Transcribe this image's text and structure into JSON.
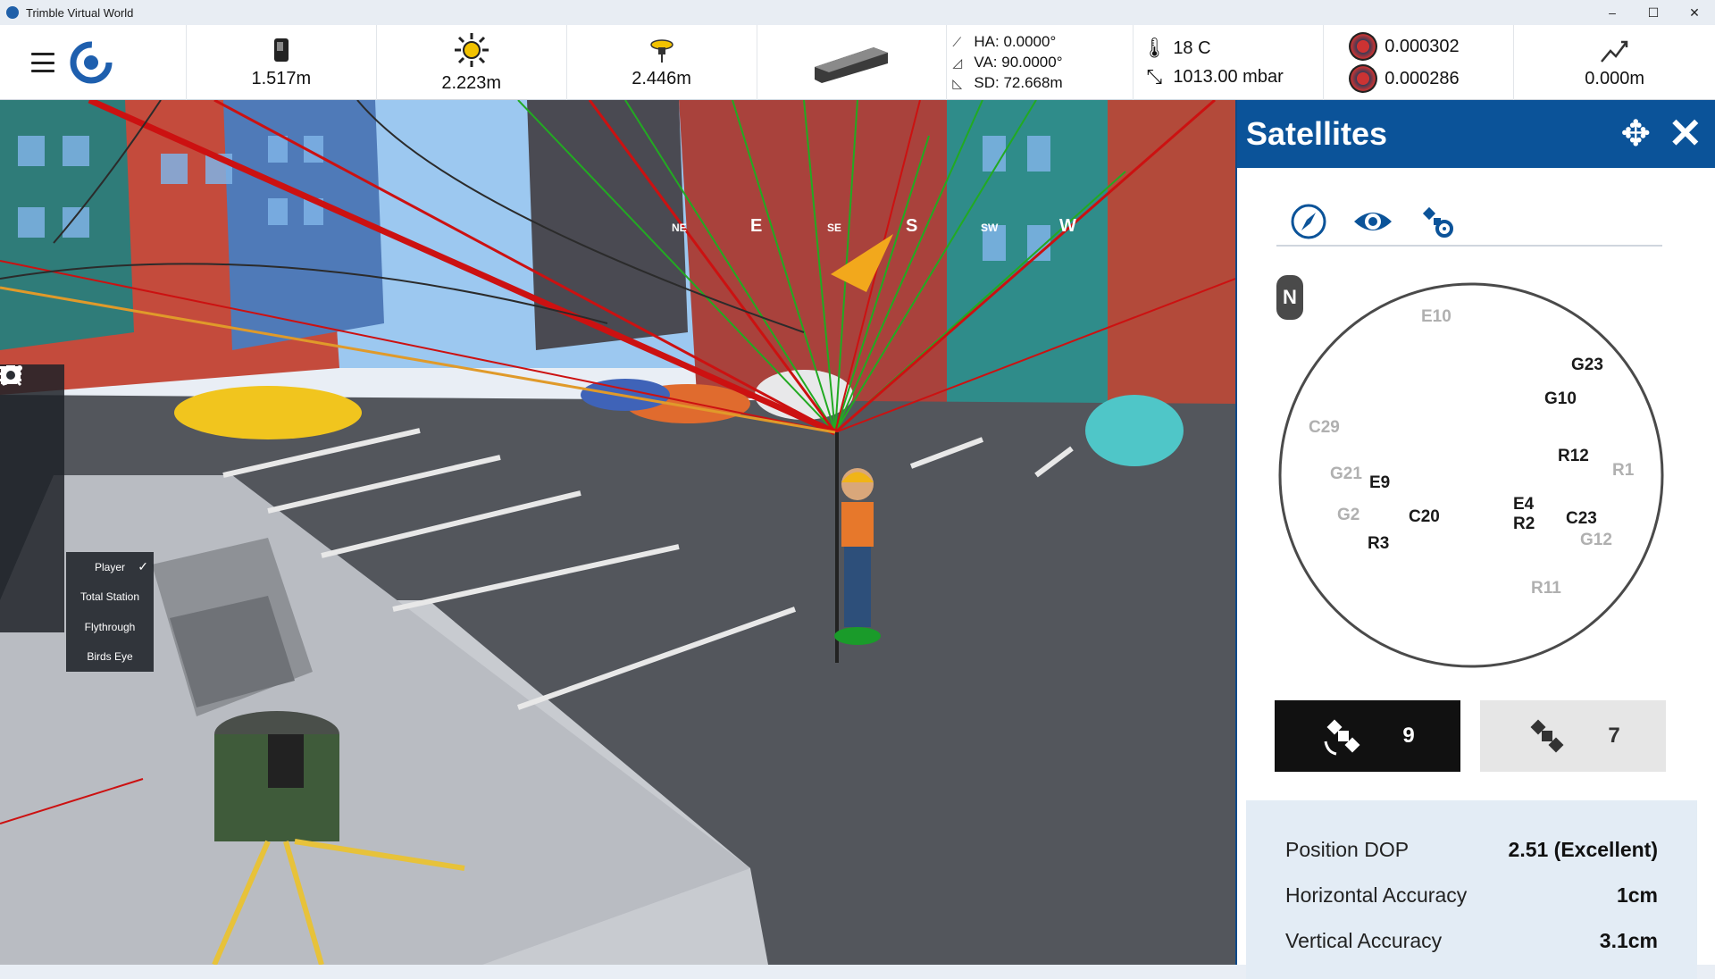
{
  "window": {
    "title": "Trimble Virtual World",
    "minimize": "–",
    "maximize": "☐",
    "close": "✕"
  },
  "toolbar": {
    "measure1": {
      "icon": "receiver-icon",
      "value": "1.517m"
    },
    "measure2": {
      "icon": "prism-sun-icon",
      "value": "2.223m"
    },
    "measure3": {
      "icon": "gnss-antenna-icon",
      "value": "2.446m"
    },
    "angles": {
      "ha": "HA: 0.0000°",
      "va": "VA: 90.0000°",
      "sd": "SD: 72.668m"
    },
    "weather": {
      "temperature": "18 C",
      "pressure": "1013.00 mbar"
    },
    "precision": {
      "horizontal": "0.000302",
      "vertical": "0.000286"
    },
    "elevation": {
      "value": "0.000m"
    }
  },
  "compass": {
    "labels": [
      "NE",
      "E",
      "SE",
      "S",
      "SW",
      "W"
    ]
  },
  "view_menu": {
    "items": [
      "Player",
      "Total Station",
      "Flythrough",
      "Birds Eye"
    ],
    "selected": "Player",
    "check": "✓"
  },
  "satellites_panel": {
    "title": "Satellites",
    "north_label": "N",
    "satellites": [
      {
        "id": "E10",
        "visible": false
      },
      {
        "id": "G23",
        "visible": true
      },
      {
        "id": "G10",
        "visible": true
      },
      {
        "id": "C29",
        "visible": false
      },
      {
        "id": "R12",
        "visible": true
      },
      {
        "id": "R1",
        "visible": false
      },
      {
        "id": "G21",
        "visible": false
      },
      {
        "id": "E9",
        "visible": true
      },
      {
        "id": "G2",
        "visible": false
      },
      {
        "id": "C20",
        "visible": true
      },
      {
        "id": "E4",
        "visible": true
      },
      {
        "id": "R2",
        "visible": true
      },
      {
        "id": "C23",
        "visible": true
      },
      {
        "id": "G12",
        "visible": false
      },
      {
        "id": "R3",
        "visible": true
      },
      {
        "id": "R11",
        "visible": false
      }
    ],
    "tracked_count": "9",
    "untracked_count": "7",
    "stats": [
      {
        "label": "Position DOP",
        "value": "2.51 (Excellent)"
      },
      {
        "label": "Horizontal Accuracy",
        "value": "1cm"
      },
      {
        "label": "Vertical Accuracy",
        "value": "3.1cm"
      }
    ]
  },
  "colors": {
    "panel_header": "#0b5399",
    "tracked_line": "#22aa22",
    "untracked_line": "#cc1111"
  }
}
